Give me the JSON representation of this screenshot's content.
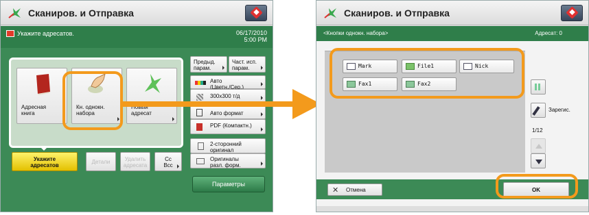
{
  "left": {
    "title": "Сканиров. и Отправка",
    "message": "Укажите адресатов.",
    "date": "06/17/2010",
    "time": "5:00 PM",
    "address_buttons": [
      {
        "label1": "Адресная",
        "label2": "книга"
      },
      {
        "label1": "Кн. однокн.",
        "label2": "набора"
      },
      {
        "label1": "Новый",
        "label2": "адресат"
      }
    ],
    "specify_button": {
      "label1": "Укажите",
      "label2": "адресатов"
    },
    "details_button": "Детали",
    "delete_button": {
      "label1": "Удалить",
      "label2": "адресата"
    },
    "cc_button": {
      "label1": "Cc",
      "label2": "Bcc"
    },
    "right_column": {
      "prev_params": {
        "label1": "Предыд.",
        "label2": "парам."
      },
      "freq_params": {
        "label1": "Част. исп.",
        "label2": "парам."
      },
      "color_mode": {
        "label1": "Авто",
        "label2": "(Цветн./Сер.)"
      },
      "resolution": "300x300 т/д",
      "size": "Авто формат",
      "format": "PDF (Компактн.)",
      "duplex": {
        "label1": "2-сторонний",
        "label2": "оригинал"
      },
      "mixed": {
        "label1": "Оригиналы",
        "label2": "разл. форм."
      },
      "parameters": "Параметры"
    }
  },
  "right": {
    "title": "Сканиров. и Отправка",
    "subheader": "<Кнопки однокн. набора>",
    "recipients": "Адресат: 0",
    "entries": [
      {
        "name": "Mark",
        "icon": "mail-icon"
      },
      {
        "name": "File1",
        "icon": "folder-icon"
      },
      {
        "name": "Nick",
        "icon": "mail-icon"
      },
      {
        "name": "Fax1",
        "icon": "fax-icon"
      },
      {
        "name": "Fax2",
        "icon": "fax-icon"
      }
    ],
    "register": "Зарегис.",
    "page": "1/12",
    "cancel": "Отмена",
    "ok": "OK"
  },
  "colors": {
    "green": "#3c8a56",
    "highlight": "#f39a1c",
    "yellow": "#f2d21a"
  }
}
